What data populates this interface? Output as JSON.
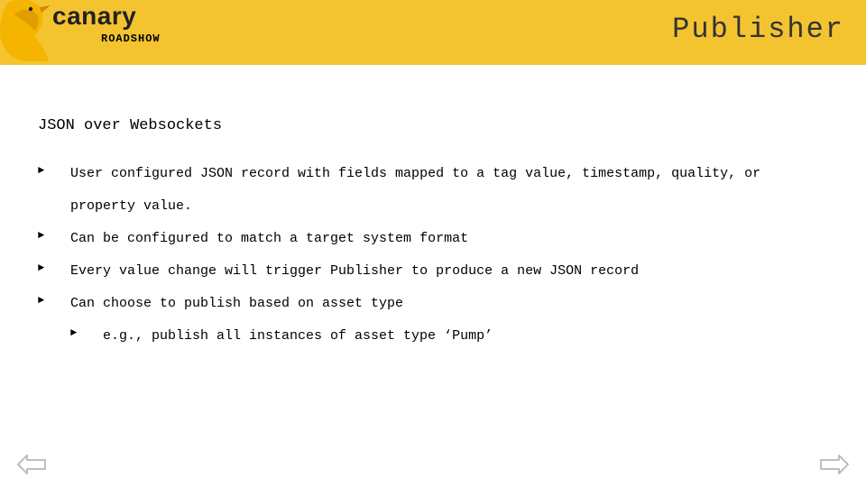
{
  "header": {
    "brand": "canary",
    "subtitle": "ROADSHOW",
    "page_title": "Publisher"
  },
  "section_heading": "JSON over Websockets",
  "bullets": [
    {
      "level": 1,
      "text": "User configured JSON record with fields mapped to a tag value, timestamp, quality, or property value."
    },
    {
      "level": 1,
      "text": "Can be configured to match a target system format"
    },
    {
      "level": 1,
      "text": "Every value change will trigger Publisher to produce a new JSON record"
    },
    {
      "level": 1,
      "text": "Can choose to publish based on asset type"
    },
    {
      "level": 2,
      "text": "e.g., publish all instances of asset type ‘Pump’"
    }
  ]
}
